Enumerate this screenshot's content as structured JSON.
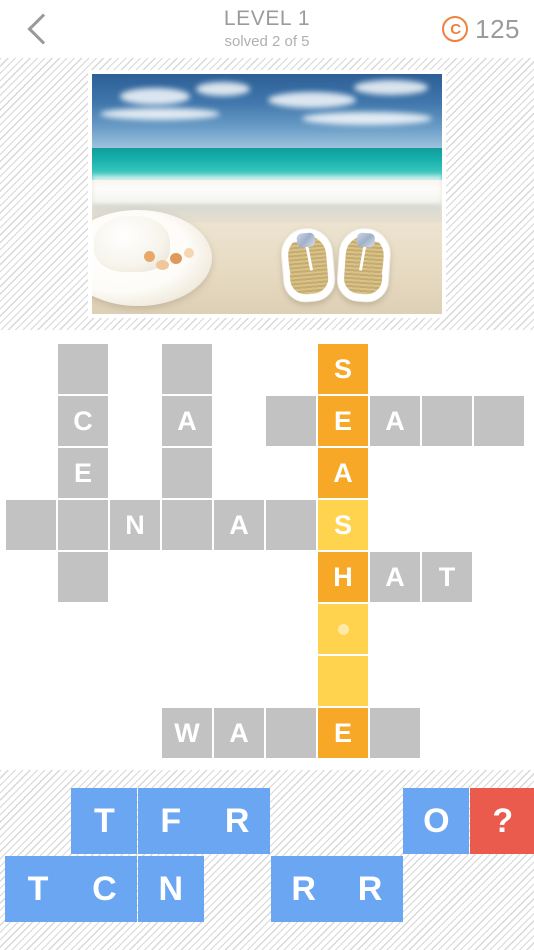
{
  "header": {
    "back_icon": "chevron-left-icon",
    "title": "LEVEL 1",
    "subtitle": "solved 2 of 5",
    "coin_icon": "coin-icon",
    "coin_glyph": "C",
    "coin_count": "125"
  },
  "puzzle_image": {
    "name": "beach-photo",
    "description": "White sun hat and flip flops on a tropical beach with turquoise sea"
  },
  "grid": {
    "columns": 10,
    "rows": 8,
    "cell_size": 50,
    "colors": {
      "empty": "#c2c2c2",
      "solved": "#f7a827",
      "active": "#ffd34e"
    },
    "cells": [
      {
        "col": 1,
        "row": 0,
        "letter": "",
        "state": "empty"
      },
      {
        "col": 3,
        "row": 0,
        "letter": "",
        "state": "empty"
      },
      {
        "col": 6,
        "row": 0,
        "letter": "S",
        "state": "solved"
      },
      {
        "col": 1,
        "row": 1,
        "letter": "C",
        "state": "empty"
      },
      {
        "col": 3,
        "row": 1,
        "letter": "A",
        "state": "empty"
      },
      {
        "col": 5,
        "row": 1,
        "letter": "",
        "state": "empty"
      },
      {
        "col": 6,
        "row": 1,
        "letter": "E",
        "state": "solved"
      },
      {
        "col": 7,
        "row": 1,
        "letter": "A",
        "state": "empty"
      },
      {
        "col": 8,
        "row": 1,
        "letter": "",
        "state": "empty"
      },
      {
        "col": 9,
        "row": 1,
        "letter": "",
        "state": "empty"
      },
      {
        "col": 1,
        "row": 2,
        "letter": "E",
        "state": "empty"
      },
      {
        "col": 3,
        "row": 2,
        "letter": "",
        "state": "empty"
      },
      {
        "col": 6,
        "row": 2,
        "letter": "A",
        "state": "solved"
      },
      {
        "col": 0,
        "row": 3,
        "letter": "",
        "state": "empty"
      },
      {
        "col": 1,
        "row": 3,
        "letter": "",
        "state": "empty"
      },
      {
        "col": 2,
        "row": 3,
        "letter": "N",
        "state": "empty"
      },
      {
        "col": 3,
        "row": 3,
        "letter": "",
        "state": "empty"
      },
      {
        "col": 4,
        "row": 3,
        "letter": "A",
        "state": "empty"
      },
      {
        "col": 5,
        "row": 3,
        "letter": "",
        "state": "empty"
      },
      {
        "col": 6,
        "row": 3,
        "letter": "S",
        "state": "active"
      },
      {
        "col": 1,
        "row": 4,
        "letter": "",
        "state": "empty"
      },
      {
        "col": 6,
        "row": 4,
        "letter": "H",
        "state": "solved"
      },
      {
        "col": 7,
        "row": 4,
        "letter": "A",
        "state": "empty"
      },
      {
        "col": 8,
        "row": 4,
        "letter": "T",
        "state": "empty"
      },
      {
        "col": 6,
        "row": 5,
        "letter": "",
        "state": "hint"
      },
      {
        "col": 6,
        "row": 6,
        "letter": "",
        "state": "active"
      },
      {
        "col": 3,
        "row": 7,
        "letter": "W",
        "state": "empty"
      },
      {
        "col": 4,
        "row": 7,
        "letter": "A",
        "state": "empty"
      },
      {
        "col": 5,
        "row": 7,
        "letter": "",
        "state": "empty"
      },
      {
        "col": 6,
        "row": 7,
        "letter": "E",
        "state": "solved"
      },
      {
        "col": 7,
        "row": 7,
        "letter": "",
        "state": "empty"
      }
    ]
  },
  "tray": {
    "columns": 8,
    "rows": 2,
    "colors": {
      "letter": "#6aa6f2",
      "joker": "#ea5a4d"
    },
    "tiles": [
      {
        "col": 0,
        "row": 0,
        "letter": "",
        "kind": "blank"
      },
      {
        "col": 1,
        "row": 0,
        "letter": "T",
        "kind": "letter"
      },
      {
        "col": 2,
        "row": 0,
        "letter": "F",
        "kind": "letter"
      },
      {
        "col": 3,
        "row": 0,
        "letter": "R",
        "kind": "letter"
      },
      {
        "col": 4,
        "row": 0,
        "letter": "",
        "kind": "blank"
      },
      {
        "col": 5,
        "row": 0,
        "letter": "",
        "kind": "blank"
      },
      {
        "col": 6,
        "row": 0,
        "letter": "O",
        "kind": "letter"
      },
      {
        "col": 7,
        "row": 0,
        "letter": "?",
        "kind": "joker"
      },
      {
        "col": 0,
        "row": 1,
        "letter": "T",
        "kind": "letter"
      },
      {
        "col": 1,
        "row": 1,
        "letter": "C",
        "kind": "letter"
      },
      {
        "col": 2,
        "row": 1,
        "letter": "N",
        "kind": "letter"
      },
      {
        "col": 3,
        "row": 1,
        "letter": "",
        "kind": "blank"
      },
      {
        "col": 4,
        "row": 1,
        "letter": "R",
        "kind": "letter"
      },
      {
        "col": 5,
        "row": 1,
        "letter": "R",
        "kind": "letter"
      },
      {
        "col": 6,
        "row": 1,
        "letter": "",
        "kind": "blank"
      },
      {
        "col": 7,
        "row": 1,
        "letter": "",
        "kind": "blank"
      }
    ]
  }
}
